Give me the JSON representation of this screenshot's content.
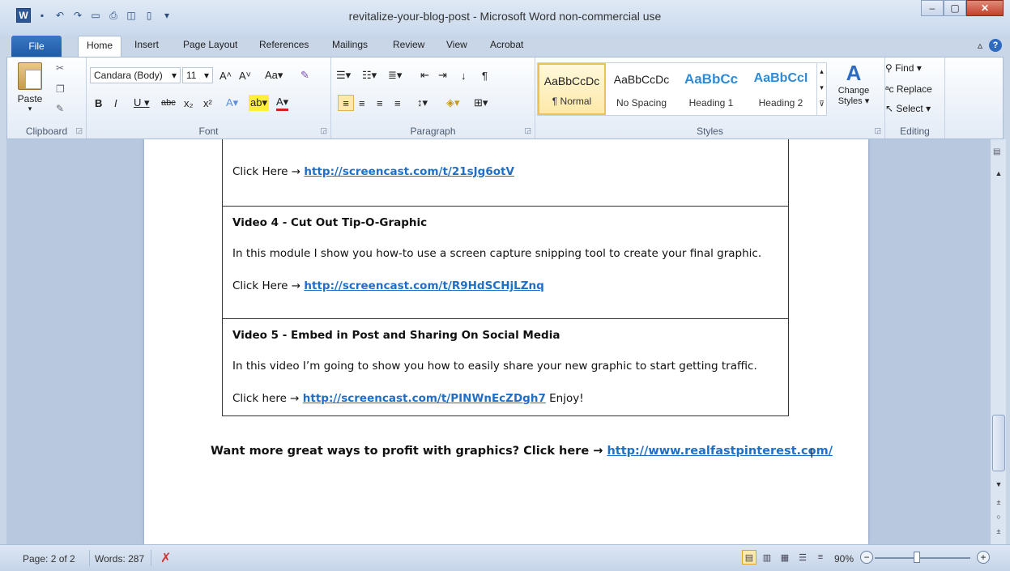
{
  "window": {
    "title": "revitalize-your-blog-post - Microsoft Word non-commercial use"
  },
  "tabs": {
    "file": "File",
    "items": [
      "Home",
      "Insert",
      "Page Layout",
      "References",
      "Mailings",
      "Review",
      "View",
      "Acrobat"
    ],
    "active": "Home"
  },
  "ribbon": {
    "clipboard": {
      "label": "Clipboard",
      "paste": "Paste"
    },
    "font": {
      "label": "Font",
      "font_name": "Candara (Body)",
      "font_size": "11"
    },
    "paragraph": {
      "label": "Paragraph"
    },
    "styles": {
      "label": "Styles",
      "items": [
        {
          "sample": "AaBbCcDc",
          "name": "¶ Normal"
        },
        {
          "sample": "AaBbCcDc",
          "name": "No Spacing"
        },
        {
          "sample": "AaBbCc",
          "name": "Heading 1"
        },
        {
          "sample": "AaBbCcI",
          "name": "Heading 2"
        }
      ],
      "change_styles": "Change Styles ▾"
    },
    "editing": {
      "label": "Editing",
      "find": "Find ▾",
      "replace": "Replace",
      "select": "Select ▾"
    }
  },
  "document": {
    "cell1": {
      "click_prefix": "Click Here →",
      "link": "http://screencast.com/t/21sJg6otV"
    },
    "cell2": {
      "title": "Video 4 - Cut Out Tip-O-Graphic",
      "body": "In this module I show you how-to use a screen capture snipping tool to create your final graphic.",
      "click_prefix": "Click Here →",
      "link": "http://screencast.com/t/R9HdSCHjLZnq"
    },
    "cell3": {
      "title": "Video 5 - Embed in Post and Sharing On Social Media",
      "body": "In this video I’m going to show you how to easily share your new graphic to start getting traffic.",
      "click_prefix": "Click here →",
      "link": "http://screencast.com/t/PINWnEcZDgh7",
      "suffix": "Enjoy!"
    },
    "footer": {
      "text": "Want more great ways to profit with graphics?  Click here →",
      "link": "http://www.realfastpinterest.com/"
    }
  },
  "status": {
    "page": "Page: 2 of 2",
    "words": "Words: 287",
    "zoom": "90%"
  }
}
